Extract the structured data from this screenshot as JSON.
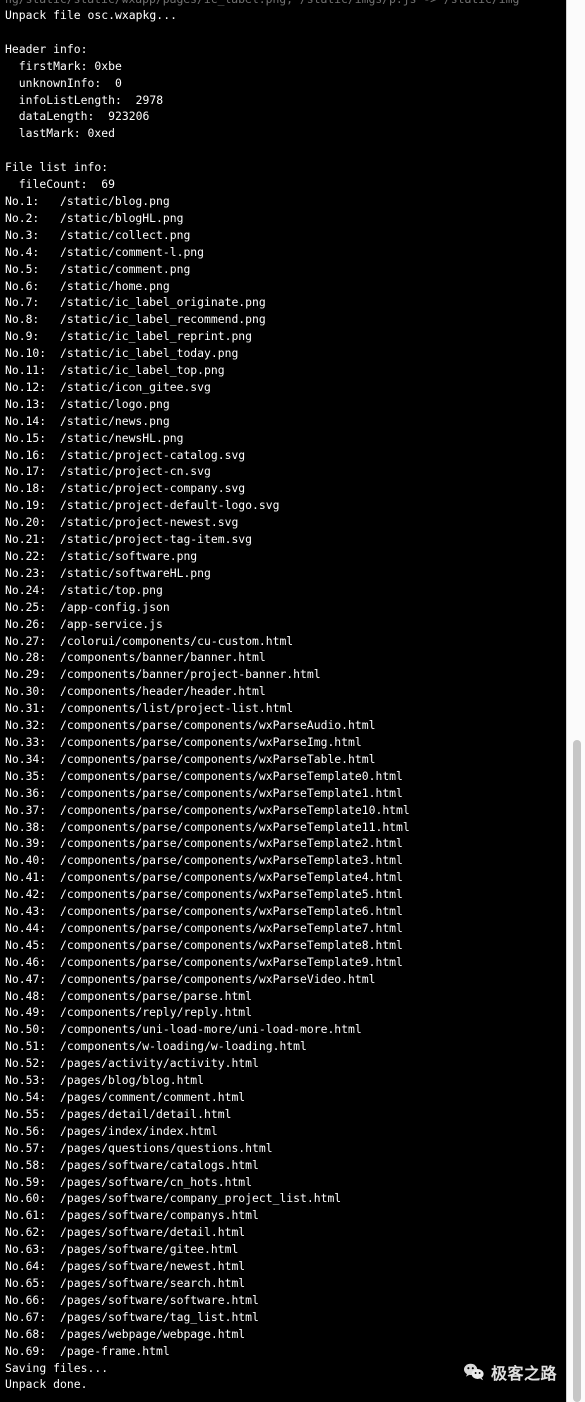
{
  "terminal": {
    "cut_off_top_line": "ng/static/static/wxapp/pages/ic_label.png; /static/imgs/p.js -> /static/img",
    "unpack_start": "Unpack file osc.wxapkg...",
    "header_section_title": "Header info:",
    "header_fields": [
      "  firstMark: 0xbe",
      "  unknownInfo:  0",
      "  infoListLength:  2978",
      "  dataLength:  923206",
      "  lastMark: 0xed"
    ],
    "filelist_section_title": "File list info:",
    "file_count_line": "  fileCount:  69",
    "files": [
      {
        "no": "No.1:",
        "path": "/static/blog.png"
      },
      {
        "no": "No.2:",
        "path": "/static/blogHL.png"
      },
      {
        "no": "No.3:",
        "path": "/static/collect.png"
      },
      {
        "no": "No.4:",
        "path": "/static/comment-l.png"
      },
      {
        "no": "No.5:",
        "path": "/static/comment.png"
      },
      {
        "no": "No.6:",
        "path": "/static/home.png"
      },
      {
        "no": "No.7:",
        "path": "/static/ic_label_originate.png"
      },
      {
        "no": "No.8:",
        "path": "/static/ic_label_recommend.png"
      },
      {
        "no": "No.9:",
        "path": "/static/ic_label_reprint.png"
      },
      {
        "no": "No.10:",
        "path": "/static/ic_label_today.png"
      },
      {
        "no": "No.11:",
        "path": "/static/ic_label_top.png"
      },
      {
        "no": "No.12:",
        "path": "/static/icon_gitee.svg"
      },
      {
        "no": "No.13:",
        "path": "/static/logo.png"
      },
      {
        "no": "No.14:",
        "path": "/static/news.png"
      },
      {
        "no": "No.15:",
        "path": "/static/newsHL.png"
      },
      {
        "no": "No.16:",
        "path": "/static/project-catalog.svg"
      },
      {
        "no": "No.17:",
        "path": "/static/project-cn.svg"
      },
      {
        "no": "No.18:",
        "path": "/static/project-company.svg"
      },
      {
        "no": "No.19:",
        "path": "/static/project-default-logo.svg"
      },
      {
        "no": "No.20:",
        "path": "/static/project-newest.svg"
      },
      {
        "no": "No.21:",
        "path": "/static/project-tag-item.svg"
      },
      {
        "no": "No.22:",
        "path": "/static/software.png"
      },
      {
        "no": "No.23:",
        "path": "/static/softwareHL.png"
      },
      {
        "no": "No.24:",
        "path": "/static/top.png"
      },
      {
        "no": "No.25:",
        "path": "/app-config.json"
      },
      {
        "no": "No.26:",
        "path": "/app-service.js"
      },
      {
        "no": "No.27:",
        "path": "/colorui/components/cu-custom.html"
      },
      {
        "no": "No.28:",
        "path": "/components/banner/banner.html"
      },
      {
        "no": "No.29:",
        "path": "/components/banner/project-banner.html"
      },
      {
        "no": "No.30:",
        "path": "/components/header/header.html"
      },
      {
        "no": "No.31:",
        "path": "/components/list/project-list.html"
      },
      {
        "no": "No.32:",
        "path": "/components/parse/components/wxParseAudio.html"
      },
      {
        "no": "No.33:",
        "path": "/components/parse/components/wxParseImg.html"
      },
      {
        "no": "No.34:",
        "path": "/components/parse/components/wxParseTable.html"
      },
      {
        "no": "No.35:",
        "path": "/components/parse/components/wxParseTemplate0.html"
      },
      {
        "no": "No.36:",
        "path": "/components/parse/components/wxParseTemplate1.html"
      },
      {
        "no": "No.37:",
        "path": "/components/parse/components/wxParseTemplate10.html"
      },
      {
        "no": "No.38:",
        "path": "/components/parse/components/wxParseTemplate11.html"
      },
      {
        "no": "No.39:",
        "path": "/components/parse/components/wxParseTemplate2.html"
      },
      {
        "no": "No.40:",
        "path": "/components/parse/components/wxParseTemplate3.html"
      },
      {
        "no": "No.41:",
        "path": "/components/parse/components/wxParseTemplate4.html"
      },
      {
        "no": "No.42:",
        "path": "/components/parse/components/wxParseTemplate5.html"
      },
      {
        "no": "No.43:",
        "path": "/components/parse/components/wxParseTemplate6.html"
      },
      {
        "no": "No.44:",
        "path": "/components/parse/components/wxParseTemplate7.html"
      },
      {
        "no": "No.45:",
        "path": "/components/parse/components/wxParseTemplate8.html"
      },
      {
        "no": "No.46:",
        "path": "/components/parse/components/wxParseTemplate9.html"
      },
      {
        "no": "No.47:",
        "path": "/components/parse/components/wxParseVideo.html"
      },
      {
        "no": "No.48:",
        "path": "/components/parse/parse.html"
      },
      {
        "no": "No.49:",
        "path": "/components/reply/reply.html"
      },
      {
        "no": "No.50:",
        "path": "/components/uni-load-more/uni-load-more.html"
      },
      {
        "no": "No.51:",
        "path": "/components/w-loading/w-loading.html"
      },
      {
        "no": "No.52:",
        "path": "/pages/activity/activity.html"
      },
      {
        "no": "No.53:",
        "path": "/pages/blog/blog.html"
      },
      {
        "no": "No.54:",
        "path": "/pages/comment/comment.html"
      },
      {
        "no": "No.55:",
        "path": "/pages/detail/detail.html"
      },
      {
        "no": "No.56:",
        "path": "/pages/index/index.html"
      },
      {
        "no": "No.57:",
        "path": "/pages/questions/questions.html"
      },
      {
        "no": "No.58:",
        "path": "/pages/software/catalogs.html"
      },
      {
        "no": "No.59:",
        "path": "/pages/software/cn_hots.html"
      },
      {
        "no": "No.60:",
        "path": "/pages/software/company_project_list.html"
      },
      {
        "no": "No.61:",
        "path": "/pages/software/companys.html"
      },
      {
        "no": "No.62:",
        "path": "/pages/software/detail.html"
      },
      {
        "no": "No.63:",
        "path": "/pages/software/gitee.html"
      },
      {
        "no": "No.64:",
        "path": "/pages/software/newest.html"
      },
      {
        "no": "No.65:",
        "path": "/pages/software/search.html"
      },
      {
        "no": "No.66:",
        "path": "/pages/software/software.html"
      },
      {
        "no": "No.67:",
        "path": "/pages/software/tag_list.html"
      },
      {
        "no": "No.68:",
        "path": "/pages/webpage/webpage.html"
      },
      {
        "no": "No.69:",
        "path": "/page-frame.html"
      }
    ],
    "saving_line": "Saving files...",
    "done_line": "Unpack done."
  },
  "watermark": {
    "icon": "wechat-icon",
    "text": "极客之路"
  },
  "colors": {
    "terminal_background": "#000000",
    "terminal_text": "#ffffff",
    "scrollbar_track": "#fbfbfb",
    "scrollbar_thumb": "#c6c6c6"
  }
}
